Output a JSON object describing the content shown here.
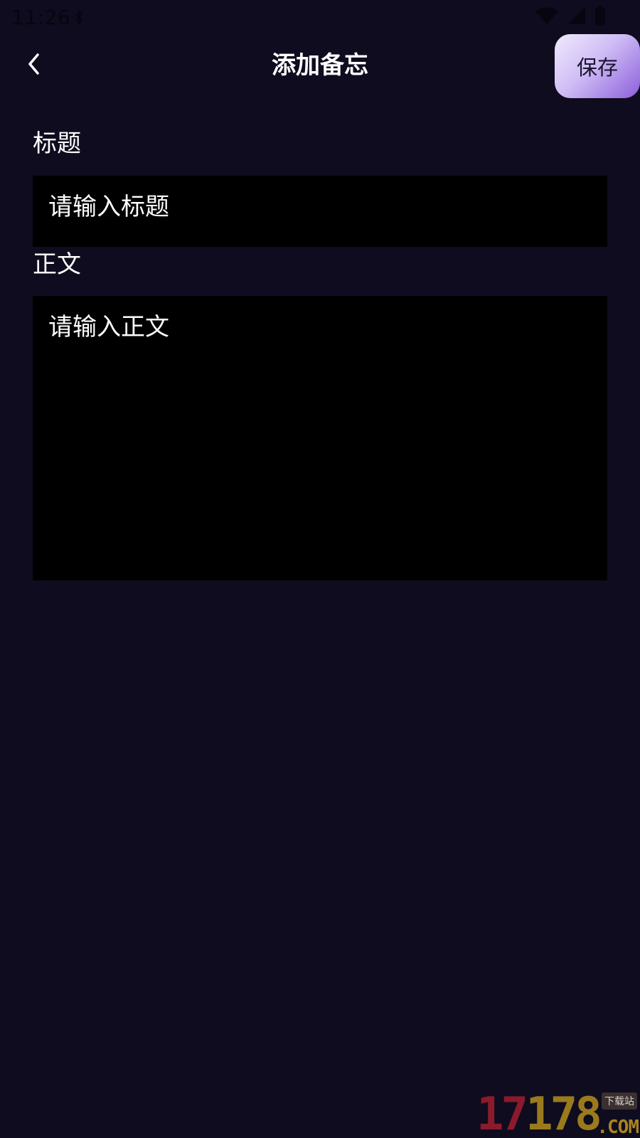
{
  "status_bar": {
    "time": "11:26",
    "icons": [
      "notification-icon",
      "wifi-icon",
      "signal-icon",
      "battery-icon"
    ]
  },
  "header": {
    "title": "添加备忘",
    "back_icon": "chevron-left-icon",
    "save_label": "保存"
  },
  "form": {
    "title_label": "标题",
    "title_placeholder": "请输入标题",
    "body_label": "正文",
    "body_placeholder": "请输入正文"
  },
  "watermark": {
    "digits_red": "17",
    "digits_gold": "178",
    "tag": "下载站",
    "domain": ".COM"
  },
  "colors": {
    "background": "#0e0c1e",
    "input_background": "#000000",
    "text": "#ffffff",
    "save_gradient_start": "#f1eafd",
    "save_gradient_end": "#8c5fdc"
  }
}
